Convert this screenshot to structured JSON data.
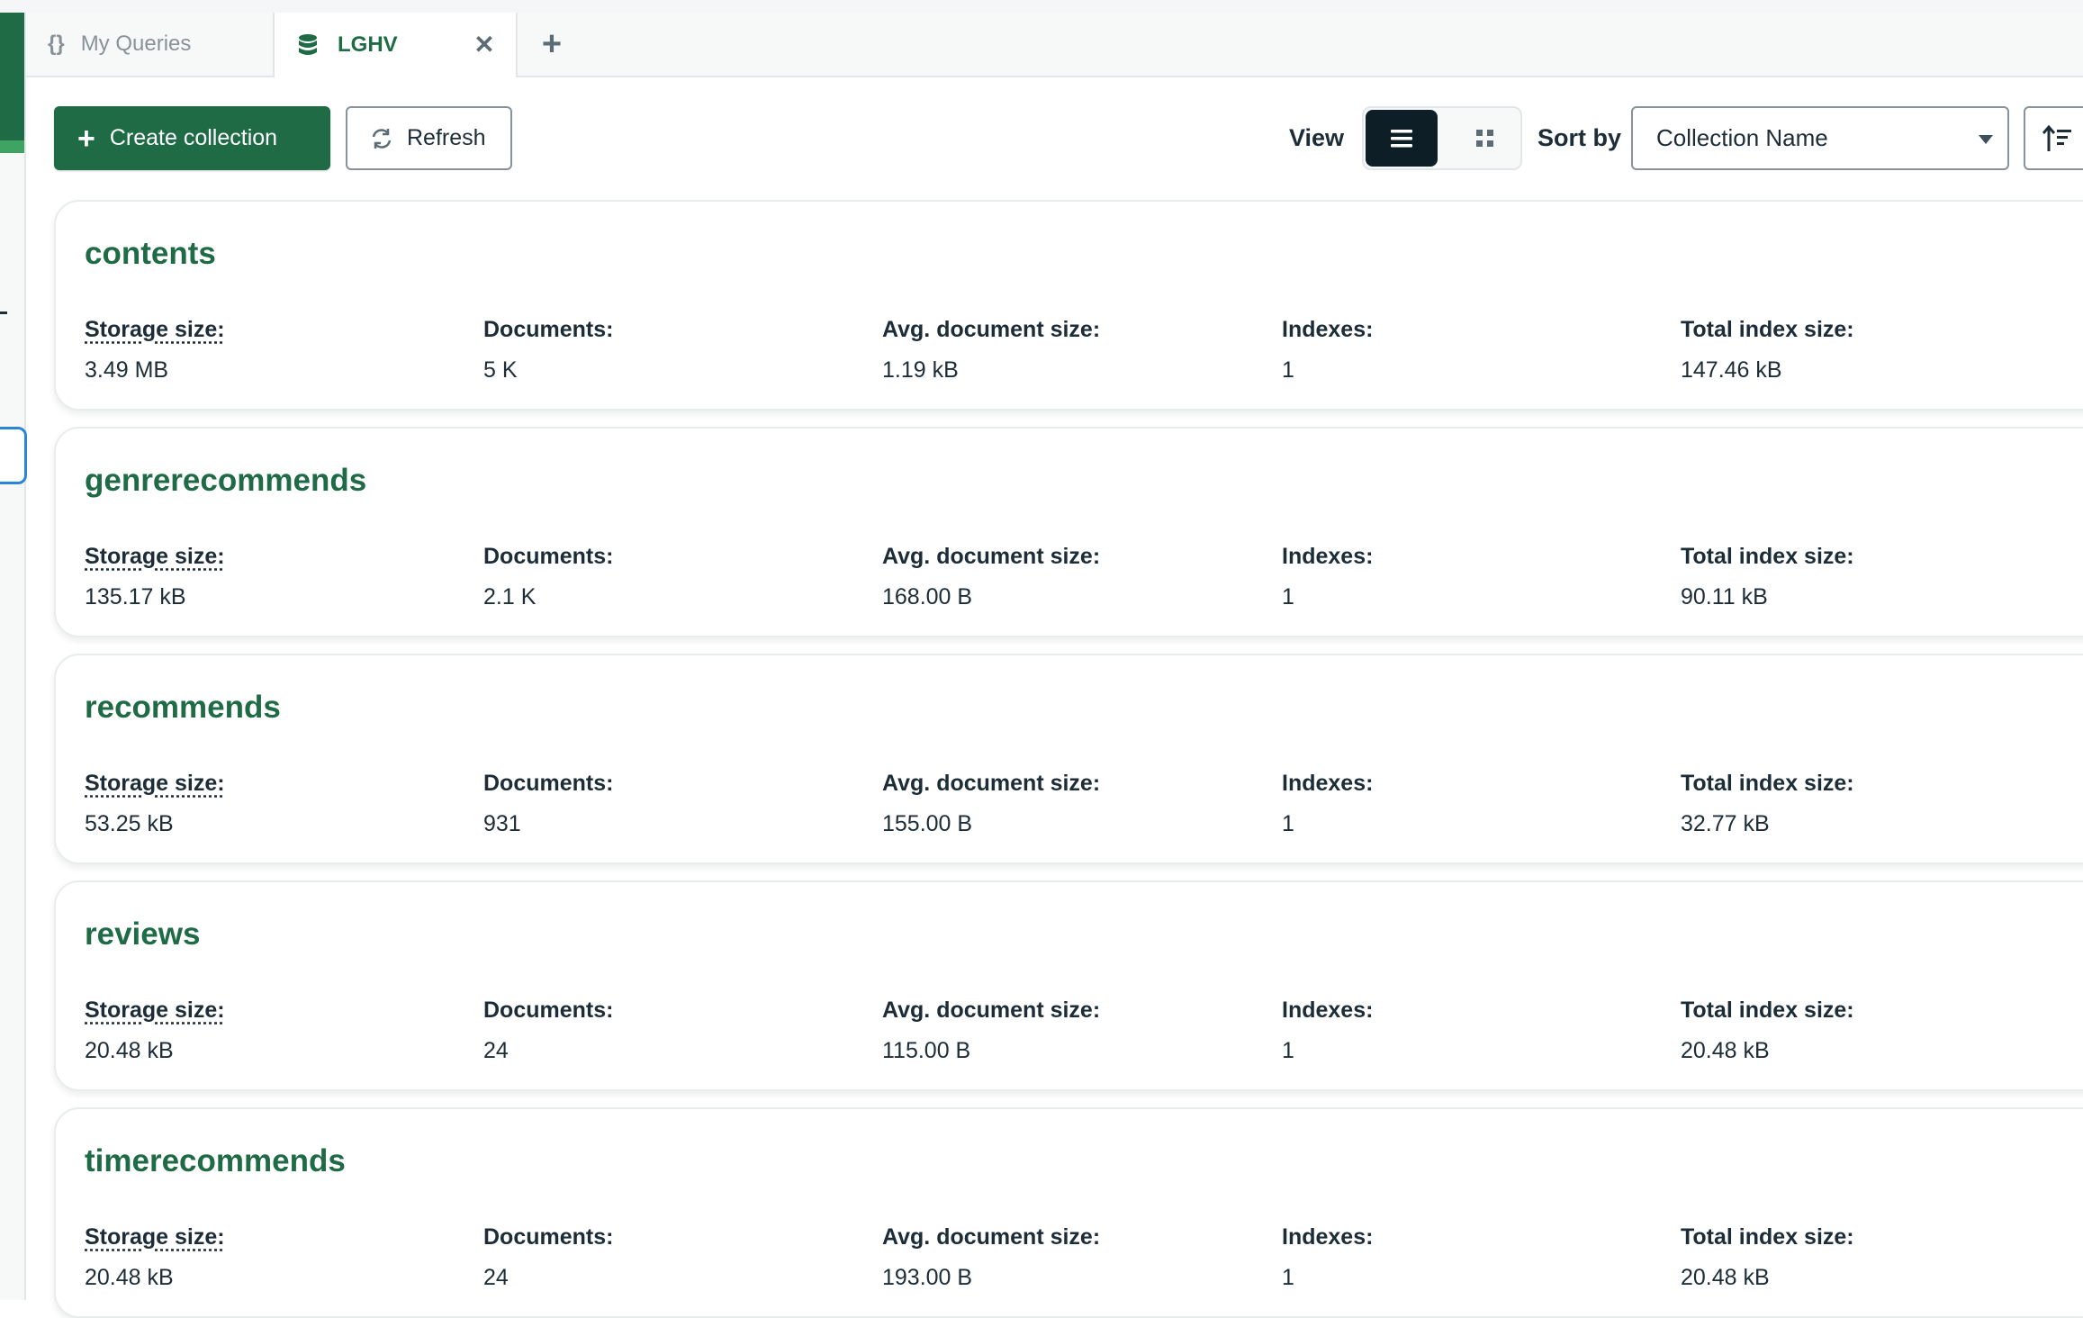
{
  "tabs": {
    "queries": {
      "icon": "braces-icon",
      "label": "My Queries"
    },
    "active": {
      "icon": "database-icon",
      "label": "LGHV"
    },
    "close_glyph": "✕",
    "add_glyph": "+"
  },
  "toolbar": {
    "create_label": "Create collection",
    "refresh_label": "Refresh",
    "view_label": "View",
    "sort_label": "Sort by",
    "sort_value": "Collection Name",
    "view_mode": "list"
  },
  "stat_labels": {
    "storage": "Storage size:",
    "documents": "Documents:",
    "avg": "Avg. document size:",
    "indexes": "Indexes:",
    "total_index": "Total index size:"
  },
  "collections": [
    {
      "name": "contents",
      "storage": "3.49 MB",
      "documents": "5 K",
      "avg": "1.19 kB",
      "indexes": "1",
      "total_index": "147.46 kB"
    },
    {
      "name": "genrerecommends",
      "storage": "135.17 kB",
      "documents": "2.1 K",
      "avg": "168.00 B",
      "indexes": "1",
      "total_index": "90.11 kB"
    },
    {
      "name": "recommends",
      "storage": "53.25 kB",
      "documents": "931",
      "avg": "155.00 B",
      "indexes": "1",
      "total_index": "32.77 kB"
    },
    {
      "name": "reviews",
      "storage": "20.48 kB",
      "documents": "24",
      "avg": "115.00 B",
      "indexes": "1",
      "total_index": "20.48 kB"
    },
    {
      "name": "timerecommends",
      "storage": "20.48 kB",
      "documents": "24",
      "avg": "193.00 B",
      "indexes": "1",
      "total_index": "20.48 kB"
    }
  ],
  "colors": {
    "brand_green": "#1f6b45",
    "dark": "#0d1e26",
    "focus_blue": "#2a86d8"
  }
}
